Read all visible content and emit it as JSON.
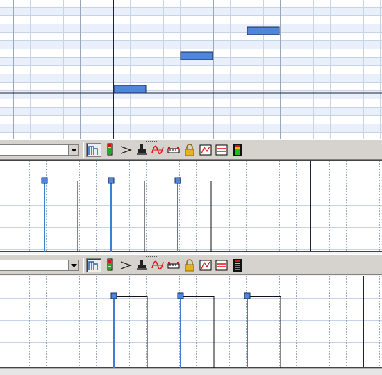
{
  "piano_roll": {
    "notes": [
      {
        "id": "note-1",
        "color": "#4f86db"
      },
      {
        "id": "note-2",
        "color": "#4f86db"
      },
      {
        "id": "note-3",
        "color": "#4f86db"
      }
    ]
  },
  "lanes": [
    {
      "id": "lane-1",
      "toolbar": {
        "combo_value": "",
        "tools": [
          {
            "icon": "automation-curve-icon",
            "active": true
          },
          {
            "icon": "level-meter-icon",
            "active": false
          },
          {
            "icon": "greater-than-icon",
            "active": false
          },
          {
            "icon": "stamp-icon",
            "active": false
          },
          {
            "icon": "wave-line-icon",
            "active": false
          },
          {
            "icon": "ruler-icon",
            "active": false
          },
          {
            "icon": "lock-icon",
            "active": false
          },
          {
            "icon": "envelope-box-icon",
            "active": false
          },
          {
            "icon": "split-box-icon",
            "active": false
          },
          {
            "icon": "meter-bars-icon",
            "active": false
          }
        ]
      },
      "events": 3
    },
    {
      "id": "lane-2",
      "toolbar": {
        "combo_value": "",
        "tools": [
          {
            "icon": "automation-curve-icon",
            "active": true
          },
          {
            "icon": "level-meter-icon",
            "active": false
          },
          {
            "icon": "greater-than-icon",
            "active": false
          },
          {
            "icon": "stamp-icon",
            "active": false
          },
          {
            "icon": "wave-line-icon",
            "active": false
          },
          {
            "icon": "ruler-icon",
            "active": false
          },
          {
            "icon": "lock-icon",
            "active": false
          },
          {
            "icon": "envelope-box-icon",
            "active": false
          },
          {
            "icon": "split-box-icon",
            "active": false
          },
          {
            "icon": "meter-bars-icon",
            "active": false
          }
        ]
      },
      "events": 3
    }
  ],
  "colors": {
    "grid_bg": "#ffffff",
    "row_alt": "#e9f0fb",
    "grid_line": "#c7d4e8",
    "beat_line": "#9aa7ba",
    "bar_line": "#1a2438",
    "event_line": "#3f7fd0",
    "toolbar_bg": "#d6d3ce"
  }
}
